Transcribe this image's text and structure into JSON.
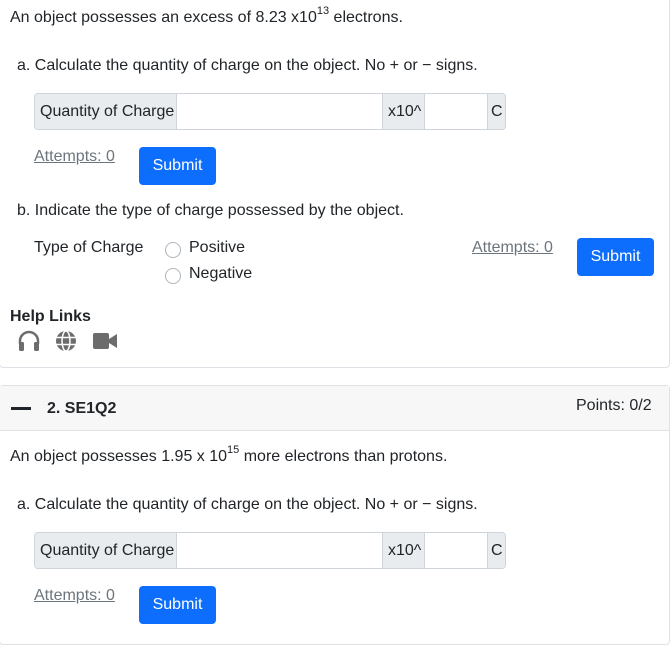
{
  "question1": {
    "stem": {
      "prefix": "An object possesses an excess of 8.23 x10",
      "exponent": "13",
      "suffix": " electrons."
    },
    "part_a": {
      "label": "a. Calculate the quantity of charge on the object. No + or − signs.",
      "input_label": "Quantity of Charge",
      "mantissa_value": "",
      "multiplier": "x10^",
      "exponent_value": "",
      "unit": "C",
      "attempts": "Attempts: 0",
      "submit": "Submit"
    },
    "part_b": {
      "label": "b. Indicate the type of charge possessed by the object.",
      "field_label": "Type of Charge",
      "options": [
        "Positive",
        "Negative"
      ],
      "attempts": "Attempts: 0",
      "submit": "Submit"
    },
    "help_links": {
      "title": "Help Links",
      "icons": [
        "headphones-icon",
        "globe-icon",
        "video-camera-icon"
      ]
    }
  },
  "question2": {
    "header": {
      "collapse_icon": "minus-icon",
      "title": "2. SE1Q2",
      "points": "Points: 0/2"
    },
    "stem": {
      "prefix": "An object possesses 1.95 x 10",
      "exponent": "15",
      "suffix": " more electrons than protons."
    },
    "part_a": {
      "label": "a. Calculate the quantity of charge on the object. No + or − signs.",
      "input_label": "Quantity of Charge",
      "mantissa_value": "",
      "multiplier": "x10^",
      "exponent_value": "",
      "unit": "C",
      "attempts": "Attempts: 0",
      "submit": "Submit"
    }
  },
  "colors": {
    "primary": "#0d6efd",
    "muted": "#6c757d",
    "addon_bg": "#e9ecef",
    "header_bg": "#f7f7f7"
  }
}
